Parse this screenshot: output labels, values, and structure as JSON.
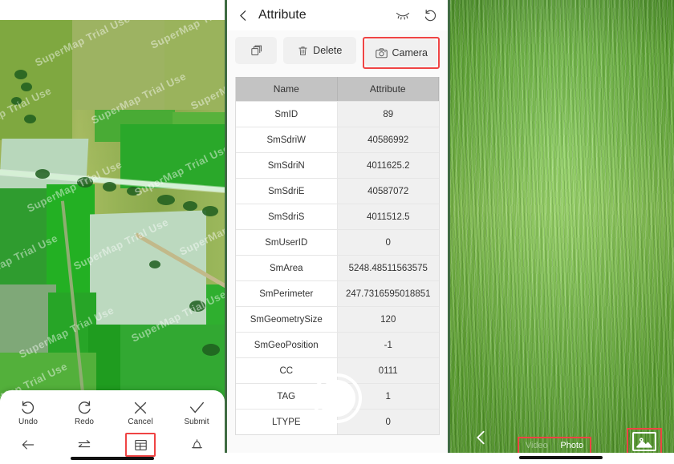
{
  "map_panel": {
    "name": "map-view",
    "watermark_text": "SuperMap Trial Use",
    "toolbar": {
      "actions": [
        {
          "label": "Undo",
          "icon": "undo-icon"
        },
        {
          "label": "Redo",
          "icon": "redo-icon"
        },
        {
          "label": "Cancel",
          "icon": "close-icon"
        },
        {
          "label": "Submit",
          "icon": "check-icon"
        }
      ],
      "nav": [
        {
          "name": "back-arrow-icon",
          "highlighted": false
        },
        {
          "name": "swap-arrows-icon",
          "highlighted": false
        },
        {
          "name": "table-icon",
          "highlighted": true
        },
        {
          "name": "bell-icon",
          "highlighted": false
        }
      ]
    }
  },
  "attribute_panel": {
    "header": {
      "back_icon": "chevron-left-icon",
      "title": "Attribute",
      "hide_icon": "eye-closed-icon",
      "revert_icon": "undo-circle-icon"
    },
    "toolbar": {
      "copy_label": "",
      "copy_icon": "copy-layers-icon",
      "delete_label": "Delete",
      "delete_icon": "trash-icon",
      "camera_label": "Camera",
      "camera_icon": "camera-icon",
      "camera_highlighted": true
    },
    "table": {
      "columns": [
        "Name",
        "Attribute"
      ],
      "rows": [
        {
          "name": "SmID",
          "value": "89"
        },
        {
          "name": "SmSdriW",
          "value": "40586992"
        },
        {
          "name": "SmSdriN",
          "value": "4011625.2"
        },
        {
          "name": "SmSdriE",
          "value": "40587072"
        },
        {
          "name": "SmSdriS",
          "value": "4011512.5"
        },
        {
          "name": "SmUserID",
          "value": "0"
        },
        {
          "name": "SmArea",
          "value": "5248.48511563575"
        },
        {
          "name": "SmPerimeter",
          "value": "247.7316595018851"
        },
        {
          "name": "SmGeometrySize",
          "value": "120"
        },
        {
          "name": "SmGeoPosition",
          "value": "-1"
        },
        {
          "name": "CC",
          "value": "0111"
        },
        {
          "name": "TAG",
          "value": "1"
        },
        {
          "name": "LTYPE",
          "value": "0"
        }
      ]
    }
  },
  "camera_panel": {
    "back_icon": "chevron-left-icon",
    "shutter_name": "shutter-button",
    "gallery_icon": "gallery-image-icon",
    "gallery_highlighted": true,
    "modes_highlighted": true,
    "modes": [
      {
        "label": "Video",
        "active": false
      },
      {
        "label": "Photo",
        "active": true
      }
    ]
  },
  "colors": {
    "highlight": "#ef4444",
    "table_header": "#c3c3c3",
    "table_value_bg": "#f0f0f0",
    "divider": "#3f6b42"
  }
}
